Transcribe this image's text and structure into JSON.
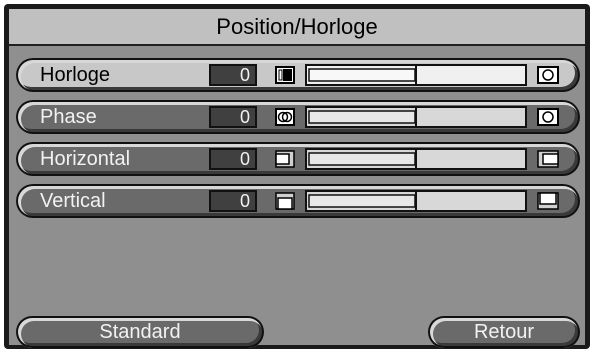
{
  "window": {
    "title": "Position/Horloge"
  },
  "rows": [
    {
      "label": "Horloge",
      "value": "0",
      "left_icon": "clock-narrow-icon",
      "right_icon": "clock-wide-icon",
      "selected": true
    },
    {
      "label": "Phase",
      "value": "0",
      "left_icon": "phase-blur-icon",
      "right_icon": "phase-sharp-icon",
      "selected": false
    },
    {
      "label": "Horizontal",
      "value": "0",
      "left_icon": "shift-left-icon",
      "right_icon": "shift-right-icon",
      "selected": false
    },
    {
      "label": "Vertical",
      "value": "0",
      "left_icon": "shift-down-icon",
      "right_icon": "shift-up-icon",
      "selected": false
    }
  ],
  "slider_level": 0.5,
  "buttons": {
    "standard": "Standard",
    "retour": "Retour"
  },
  "colors": {
    "selected_row": "#c8c8c8",
    "row": "#6a6a6a",
    "panel": "#8f8f8f",
    "title_bar": "#c0c0c0"
  }
}
